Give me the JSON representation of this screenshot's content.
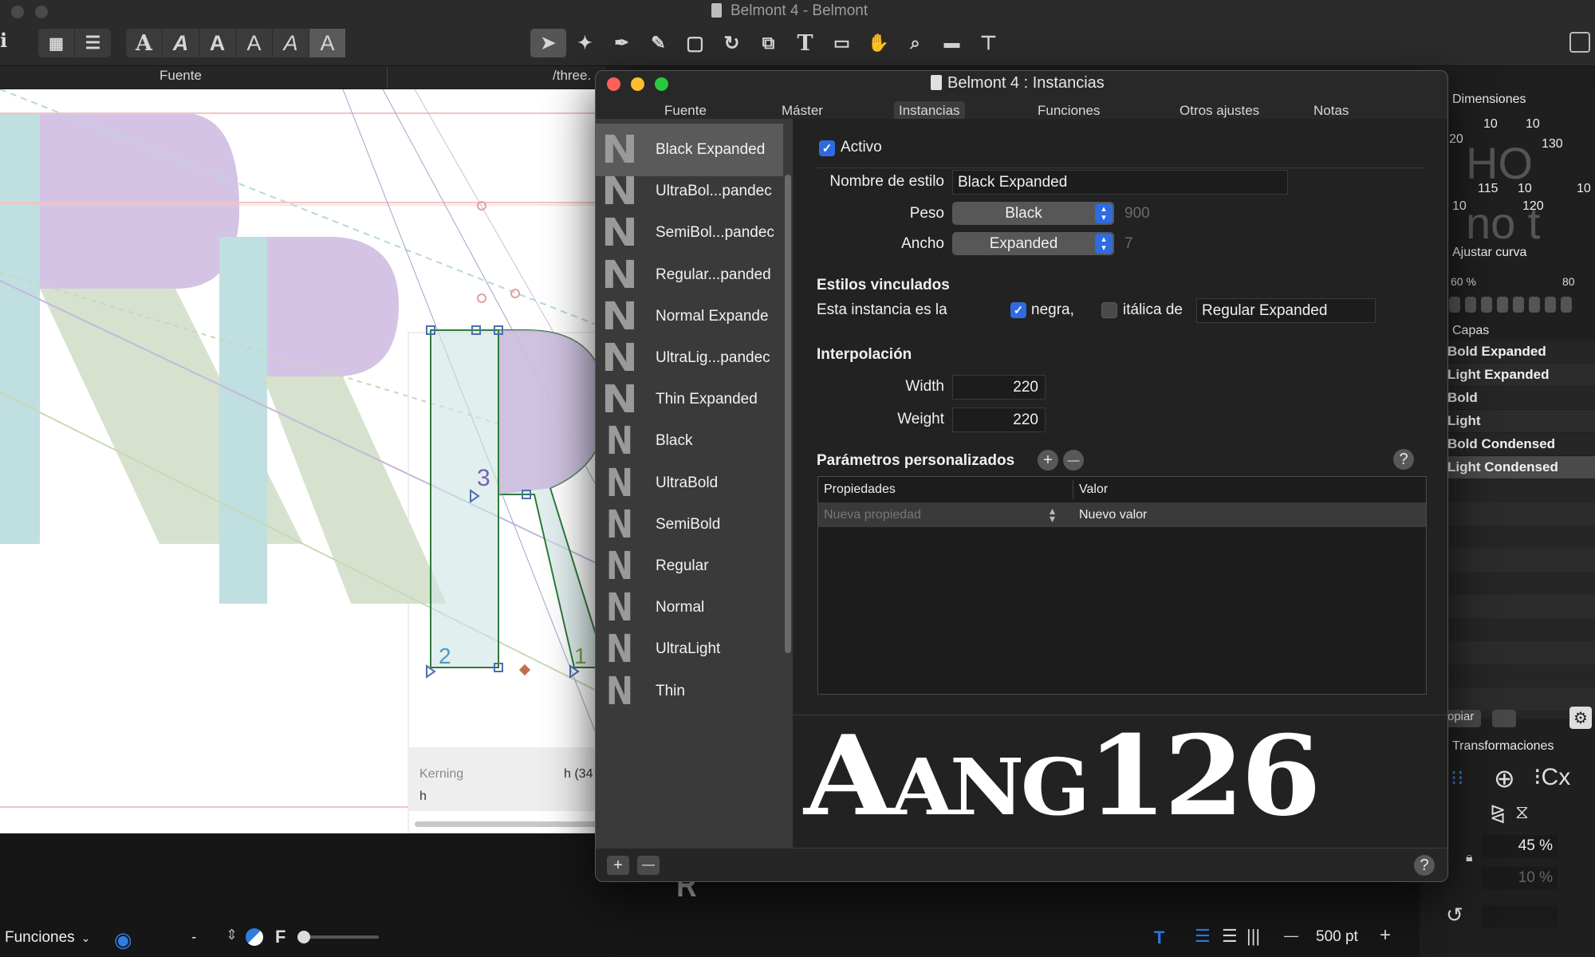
{
  "window": {
    "title": "Belmont 4 - Belmont",
    "info_label": "i",
    "tab_left": "Fuente",
    "tab_right": "/three."
  },
  "toolbar": {
    "font_samples": [
      "A",
      "A",
      "A",
      "A",
      "A",
      "A"
    ]
  },
  "dialog": {
    "title": "Belmont 4 : Instancias",
    "tabs": [
      "Fuente",
      "Máster",
      "Instancias",
      "Funciones",
      "Otros ajustes",
      "Notas"
    ],
    "active_tab": "Instancias",
    "instances": [
      {
        "glyph": "N",
        "label": "Black Expanded"
      },
      {
        "glyph": "N",
        "label": "UltraBol...pandec"
      },
      {
        "glyph": "N",
        "label": "SemiBol...pandec"
      },
      {
        "glyph": "N",
        "label": "Regular...panded"
      },
      {
        "glyph": "N",
        "label": "Normal Expande"
      },
      {
        "glyph": "N",
        "label": "UltraLig...pandec"
      },
      {
        "glyph": "N",
        "label": "Thin Expanded"
      },
      {
        "glyph": "N",
        "label": "Black"
      },
      {
        "glyph": "N",
        "label": "UltraBold"
      },
      {
        "glyph": "N",
        "label": "SemiBold"
      },
      {
        "glyph": "N",
        "label": "Regular"
      },
      {
        "glyph": "N",
        "label": "Normal"
      },
      {
        "glyph": "N",
        "label": "UltraLight"
      },
      {
        "glyph": "N",
        "label": "Thin"
      }
    ],
    "selected_instance": "Black Expanded",
    "active_label": "Activo",
    "active_checked": true,
    "style_name_label": "Nombre de estilo",
    "style_name_value": "Black Expanded",
    "weight_label": "Peso",
    "weight_value": "Black",
    "weight_number": "900",
    "width_label": "Ancho",
    "width_value": "Expanded",
    "width_number": "7",
    "linked_styles_header": "Estilos vinculados",
    "linked_text_prefix": "Esta instancia es la",
    "linked_bold_label": "negra,",
    "linked_bold_checked": true,
    "linked_italic_label": "itálica de",
    "linked_italic_checked": false,
    "linked_style_value": "Regular Expanded",
    "interpolation_header": "Interpolación",
    "interp_width_label": "Width",
    "interp_width_value": "220",
    "interp_weight_label": "Weight",
    "interp_weight_value": "220",
    "custom_params_header": "Parámetros personalizados",
    "table_headers": [
      "Propiedades",
      "Valor"
    ],
    "table_row": {
      "property_placeholder": "Nueva propiedad",
      "value": "Nuevo valor"
    },
    "preview_text": "Aang126",
    "add_symbol": "+",
    "remove_symbol": "—",
    "help_symbol": "?"
  },
  "canvas": {
    "kerning_label": "Kerning",
    "kerning_value": "h (34",
    "glyph_name": "h",
    "node_numbers": [
      "3",
      "2",
      "1"
    ]
  },
  "bottombar": {
    "functions_label": "Funciones",
    "dash": "-",
    "f_label": "F",
    "size_value": "500 pt",
    "minus": "—",
    "plus": "+",
    "glyph_preview": "R"
  },
  "rightpanel": {
    "dimensions_label": "Dimensiones",
    "dim_numbers_top": [
      "10",
      "10",
      "20",
      "130"
    ],
    "dim_numbers_bottom": [
      "115",
      "10",
      "10",
      "10",
      "120"
    ],
    "curve_label": "Ajustar curva",
    "curve_left": "60 %",
    "curve_right": "80",
    "layers_label": "Capas",
    "layers": [
      "Bold Expanded",
      "Light Expanded",
      "Bold",
      "Light",
      "Bold Condensed",
      "Light Condensed"
    ],
    "copy_label": "opiar",
    "transform_label": "Transformaciones",
    "scale_value": "45 %",
    "scale_value2": "10 %"
  },
  "colors": {
    "accent_blue": "#2f6be0",
    "selection_gray": "#5a5a5a",
    "traffic_red": "#fe5f57",
    "traffic_yellow": "#febc2e",
    "traffic_green": "#28c840"
  }
}
